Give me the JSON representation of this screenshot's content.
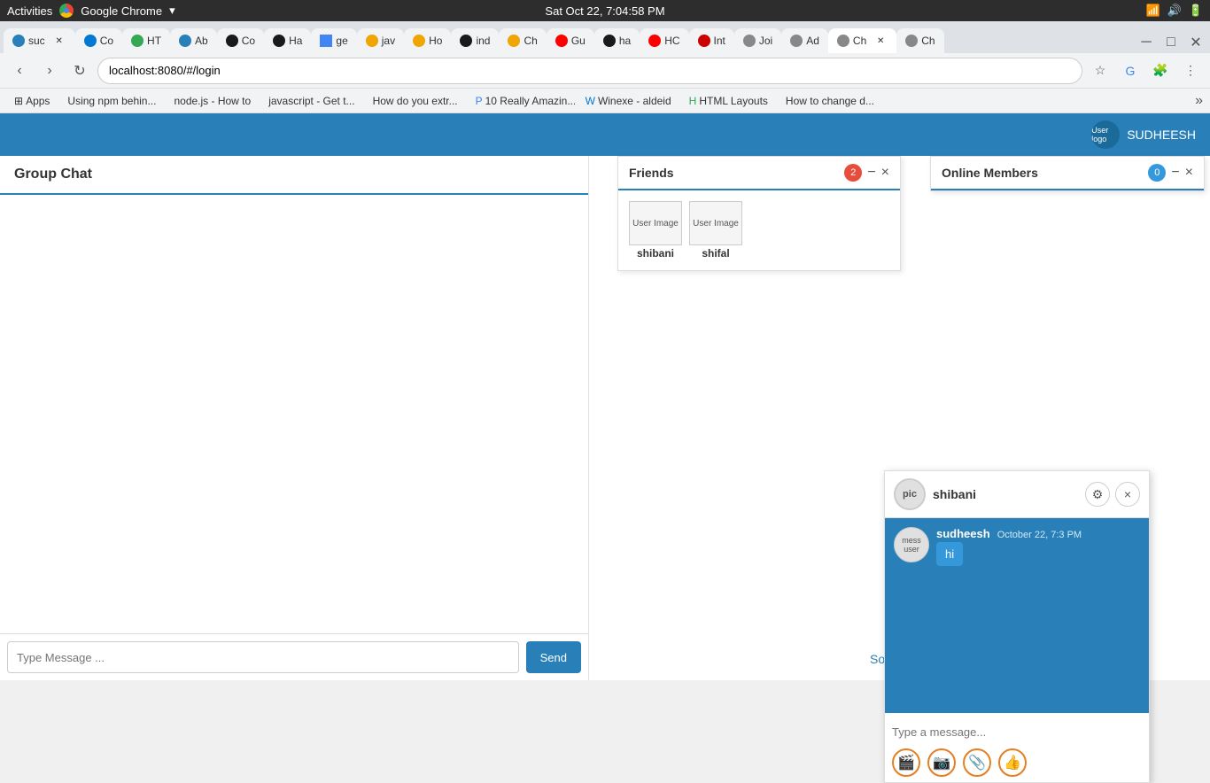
{
  "os_bar": {
    "activities": "Activities",
    "browser": "Google Chrome",
    "datetime": "Sat Oct 22,  7:04:58 PM"
  },
  "tabs": [
    {
      "label": "suc",
      "favicon_color": "#2980b9",
      "active": false
    },
    {
      "label": "Co",
      "favicon_color": "#0078d4",
      "active": false
    },
    {
      "label": "HT",
      "favicon_color": "#34a853",
      "active": false
    },
    {
      "label": "Ab",
      "favicon_color": "#2980b9",
      "active": false
    },
    {
      "label": "Co",
      "favicon_color": "#1a1a1a",
      "active": false
    },
    {
      "label": "Ha",
      "favicon_color": "#1a1a1a",
      "active": false
    },
    {
      "label": "ge",
      "favicon_color": "#4285f4",
      "active": false
    },
    {
      "label": "jav",
      "favicon_color": "#f0a500",
      "active": false
    },
    {
      "label": "Ho",
      "favicon_color": "#f0a500",
      "active": false
    },
    {
      "label": "ind",
      "favicon_color": "#1a1a1a",
      "active": false
    },
    {
      "label": "Ch",
      "favicon_color": "#f0a500",
      "active": false
    },
    {
      "label": "Gu",
      "favicon_color": "#ff0000",
      "active": false
    },
    {
      "label": "ha",
      "favicon_color": "#1a1a1a",
      "active": false
    },
    {
      "label": "HC",
      "favicon_color": "#ff0000",
      "active": false
    },
    {
      "label": "Int",
      "favicon_color": "#cc0000",
      "active": false
    },
    {
      "label": "Joi",
      "favicon_color": "#555",
      "active": false
    },
    {
      "label": "Ad",
      "favicon_color": "#555",
      "active": false
    },
    {
      "label": "Ch",
      "favicon_color": "#555",
      "active": true
    },
    {
      "label": "Ch",
      "favicon_color": "#555",
      "active": false
    }
  ],
  "address_bar": {
    "url": "localhost:8080/#/login"
  },
  "bookmarks": [
    {
      "label": "Apps"
    },
    {
      "label": "Using npm behin..."
    },
    {
      "label": "node.js - How to"
    },
    {
      "label": "javascript - Get t..."
    },
    {
      "label": "How do you extr..."
    },
    {
      "label": "10 Really Amazin..."
    },
    {
      "label": "Winexe - aldeid"
    },
    {
      "label": "HTML Layouts"
    },
    {
      "label": "How to change d..."
    }
  ],
  "app_header": {
    "username": "SUDHEESH"
  },
  "group_chat": {
    "title": "Group Chat",
    "input_placeholder": "Type Message ...",
    "send_label": "Send"
  },
  "middle": {
    "something_label": "Something"
  },
  "friends_panel": {
    "title": "Friends",
    "badge": "2",
    "minimize_label": "−",
    "close_label": "×",
    "friends": [
      {
        "name": "shibani",
        "image_label": "User Image"
      },
      {
        "name": "shifal",
        "image_label": "User Image"
      }
    ]
  },
  "online_panel": {
    "title": "Online Members",
    "badge": "0",
    "minimize_label": "−",
    "close_label": "×"
  },
  "private_chat": {
    "contact_name": "shibani",
    "pic_label": "pic",
    "gear_label": "⚙",
    "close_label": "×",
    "messages": [
      {
        "sender": "sudheesh",
        "time": "October 22, 7:3 PM",
        "text": "hi",
        "avatar_label": "mess user"
      }
    ],
    "input_placeholder": "Type a message...",
    "toolbar_buttons": [
      "🎬",
      "📷",
      "📎",
      "👍"
    ]
  }
}
